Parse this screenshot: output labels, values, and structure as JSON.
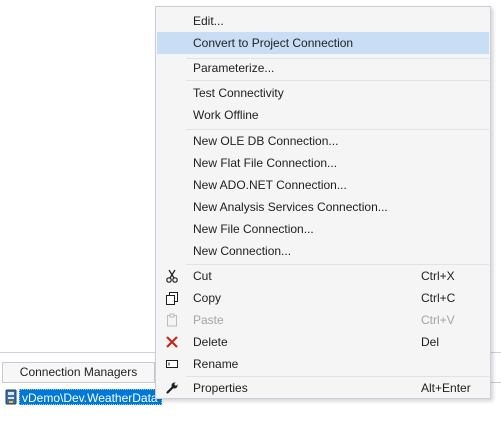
{
  "connection_managers": {
    "tab_label": "Connection Managers",
    "selected_item": "vDemo\\Dev.WeatherData",
    "item_icon": "database-connection-icon"
  },
  "context_menu": {
    "items": {
      "edit": {
        "label": "Edit..."
      },
      "convert": {
        "label": "Convert to Project Connection"
      },
      "parameterize": {
        "label": "Parameterize..."
      },
      "test": {
        "label": "Test Connectivity"
      },
      "offline": {
        "label": "Work Offline"
      },
      "oledb": {
        "label": "New OLE DB Connection..."
      },
      "flatfile": {
        "label": "New Flat File Connection..."
      },
      "adonet": {
        "label": "New ADO.NET Connection..."
      },
      "analysis": {
        "label": "New Analysis Services Connection..."
      },
      "file": {
        "label": "New File Connection..."
      },
      "connection": {
        "label": "New Connection..."
      },
      "cut": {
        "label": "Cut",
        "shortcut": "Ctrl+X",
        "icon": "scissors-icon"
      },
      "copy": {
        "label": "Copy",
        "shortcut": "Ctrl+C",
        "icon": "copy-icon"
      },
      "paste": {
        "label": "Paste",
        "shortcut": "Ctrl+V",
        "icon": "paste-icon",
        "disabled": true
      },
      "delete": {
        "label": "Delete",
        "shortcut": "Del",
        "icon": "delete-x-icon"
      },
      "rename": {
        "label": "Rename",
        "icon": "rename-icon"
      },
      "properties": {
        "label": "Properties",
        "shortcut": "Alt+Enter",
        "icon": "wrench-icon"
      }
    },
    "highlighted": "convert"
  },
  "colors": {
    "menu_bg": "#f5f5f5",
    "highlight": "#c9def5",
    "selection": "#0078d7",
    "disabled_text": "#a2a4a5",
    "delete_red": "#c42b1c"
  }
}
